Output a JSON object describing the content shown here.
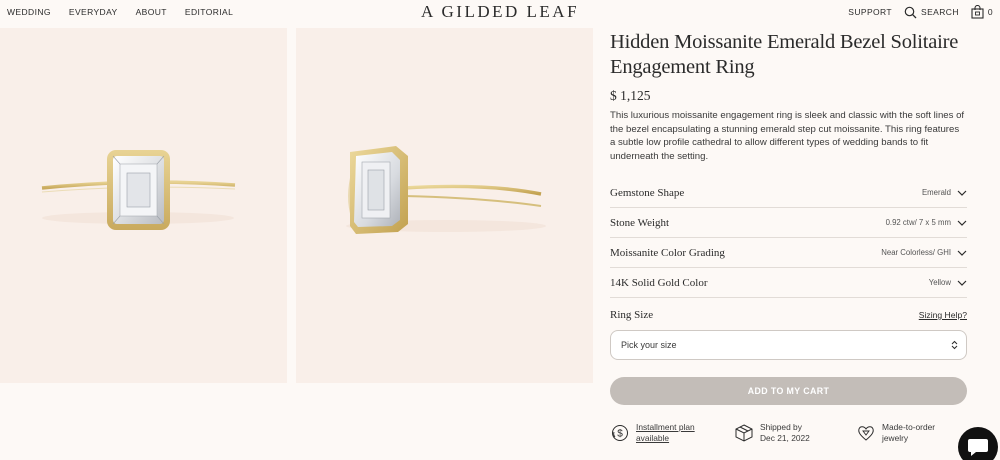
{
  "nav": {
    "left": [
      "WEDDING",
      "EVERYDAY",
      "ABOUT",
      "EDITORIAL"
    ],
    "logo": "A GILDED LEAF",
    "support": "SUPPORT",
    "search": "SEARCH",
    "cart_count": "0"
  },
  "product": {
    "title": "Hidden Moissanite Emerald Bezel Solitaire Engagement Ring",
    "price": "$ 1,125",
    "description": "This luxurious moissanite engagement ring is sleek and classic with the soft lines of the bezel encapsulating a stunning emerald step cut moissanite. This ring features a subtle low profile cathedral to allow different types of wedding bands to fit underneath the setting."
  },
  "options": [
    {
      "label": "Gemstone Shape",
      "value": "Emerald"
    },
    {
      "label": "Stone Weight",
      "value": "0.92 ctw/ 7 x 5 mm"
    },
    {
      "label": "Moissanite Color Grading",
      "value": "Near Colorless/ GHI"
    },
    {
      "label": "14K Solid Gold Color",
      "value": "Yellow"
    }
  ],
  "ring_size": {
    "label": "Ring Size",
    "help": "Sizing Help?",
    "placeholder": "Pick your size"
  },
  "cart_button": "ADD TO MY CART",
  "perks": [
    {
      "icon": "dollar-coin-icon",
      "line1": "Installment plan",
      "line2": "available"
    },
    {
      "icon": "package-box-icon",
      "line1": "Shipped by",
      "line2": "Dec 21, 2022"
    },
    {
      "icon": "diamond-heart-icon",
      "line1": "Made-to-order",
      "line2": "jewelry"
    }
  ],
  "colors": {
    "background": "#fdf9f6",
    "photo_bg": "#f9efe9",
    "gold": "#d9c07a",
    "button_disabled": "#c3bdb8"
  }
}
